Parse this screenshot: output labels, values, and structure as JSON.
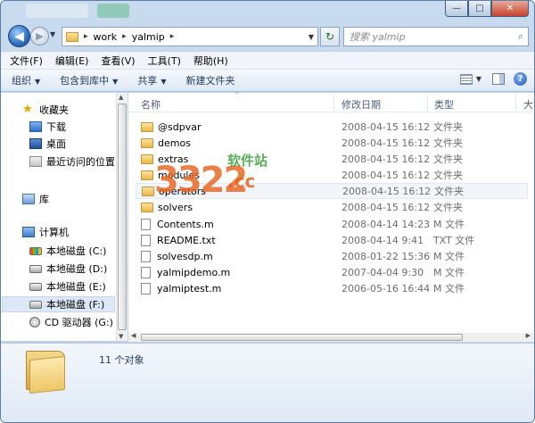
{
  "window": {
    "controls": {
      "minimize": "—",
      "maximize": "□",
      "close": "✕"
    }
  },
  "navigation": {
    "back_glyph": "◀",
    "forward_glyph": "▶",
    "history_glyph": "▼",
    "breadcrumb": [
      "work",
      "yalmip"
    ],
    "breadcrumb_sep": "▸",
    "dropdown_glyph": "▼",
    "refresh_glyph": "↻",
    "search_placeholder": "搜索 yalmip",
    "search_icon": "⌕"
  },
  "menubar": [
    "文件(F)",
    "编辑(E)",
    "查看(V)",
    "工具(T)",
    "帮助(H)"
  ],
  "commandbar": {
    "items": [
      {
        "label": "组织",
        "arrow": "▼"
      },
      {
        "label": "包含到库中",
        "arrow": "▼"
      },
      {
        "label": "共享",
        "arrow": "▼"
      },
      {
        "label": "新建文件夹",
        "arrow": ""
      }
    ],
    "view_arrow": "▼",
    "help": "?"
  },
  "sidebar": {
    "favorites": {
      "label": "收藏夹",
      "items": [
        "下载",
        "桌面",
        "最近访问的位置"
      ]
    },
    "libraries": {
      "label": "库"
    },
    "computer": {
      "label": "计算机",
      "drives": [
        "本地磁盘 (C:)",
        "本地磁盘 (D:)",
        "本地磁盘 (E:)",
        "本地磁盘 (F:)",
        "CD 驱动器 (G:)"
      ]
    },
    "scroll_up": "▲",
    "scroll_down": "▼"
  },
  "columns": {
    "name": "名称",
    "date": "修改日期",
    "type": "类型",
    "more": "大"
  },
  "files": [
    {
      "name": "@sdpvar",
      "date": "2008-04-15 16:12",
      "type": "文件夹",
      "kind": "folder"
    },
    {
      "name": "demos",
      "date": "2008-04-15 16:12",
      "type": "文件夹",
      "kind": "folder"
    },
    {
      "name": "extras",
      "date": "2008-04-15 16:12",
      "type": "文件夹",
      "kind": "folder"
    },
    {
      "name": "modules",
      "date": "2008-04-15 16:12",
      "type": "文件夹",
      "kind": "folder"
    },
    {
      "name": "operators",
      "date": "2008-04-15 16:12",
      "type": "文件夹",
      "kind": "folder"
    },
    {
      "name": "solvers",
      "date": "2008-04-15 16:12",
      "type": "文件夹",
      "kind": "folder"
    },
    {
      "name": "Contents.m",
      "date": "2008-04-14 14:23",
      "type": "M 文件",
      "kind": "file"
    },
    {
      "name": "README.txt",
      "date": "2008-04-14 9:41",
      "type": "TXT 文件",
      "kind": "file"
    },
    {
      "name": "solvesdp.m",
      "date": "2008-01-22 15:36",
      "type": "M 文件",
      "kind": "file"
    },
    {
      "name": "yalmipdemo.m",
      "date": "2007-04-04 9:30",
      "type": "M 文件",
      "kind": "file"
    },
    {
      "name": "yalmiptest.m",
      "date": "2006-05-16 16:44",
      "type": "M 文件",
      "kind": "file"
    }
  ],
  "hscroll": {
    "left": "◀",
    "right": "▶"
  },
  "status": {
    "count": "11 个对象"
  },
  "watermark": {
    "number": "3322",
    "site": "软件站",
    "domain": ".cc"
  },
  "colors": {
    "accent": "#1e395b",
    "selection": "#dde8f6",
    "folder": "#e7b84b"
  }
}
